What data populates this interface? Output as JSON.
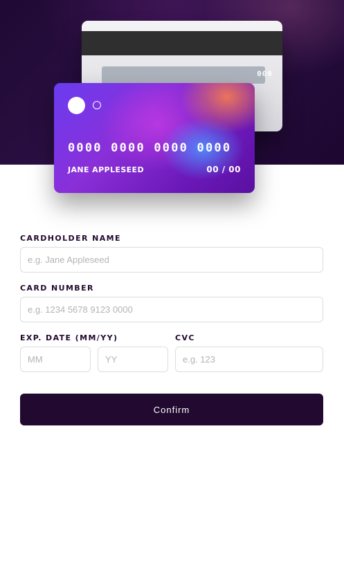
{
  "card_back": {
    "cvc": "000"
  },
  "card_front": {
    "number": "0000 0000 0000 0000",
    "holder": "JANE APPLESEED",
    "expiry": "00 / 00"
  },
  "form": {
    "name_label": "CARDHOLDER NAME",
    "name_placeholder": "e.g. Jane Appleseed",
    "number_label": "CARD NUMBER",
    "number_placeholder": "e.g. 1234 5678 9123 0000",
    "exp_label": "EXP. DATE (MM/YY)",
    "month_placeholder": "MM",
    "year_placeholder": "YY",
    "cvc_label": "CVC",
    "cvc_placeholder": "e.g. 123",
    "confirm_label": "Confirm"
  },
  "colors": {
    "dark_violet": "#21092f",
    "border": "#dedddf"
  }
}
